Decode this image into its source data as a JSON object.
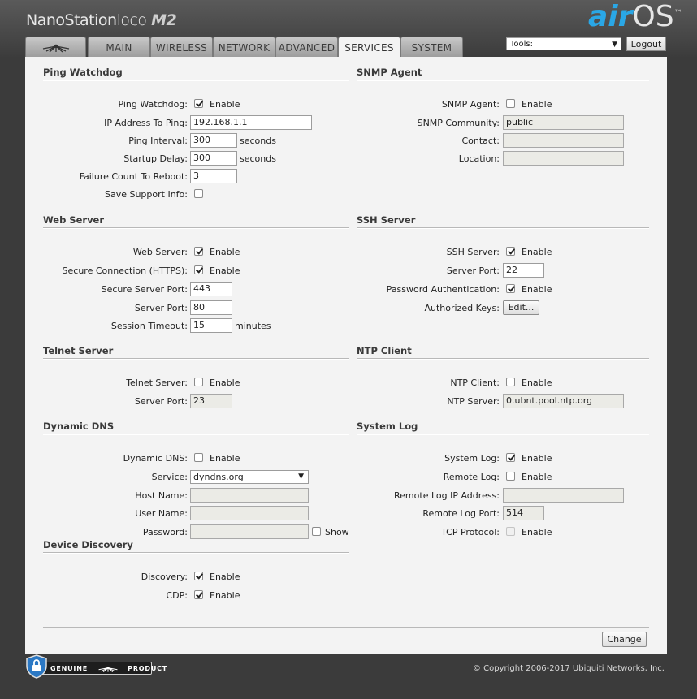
{
  "header": {
    "model_name": "NanoStation",
    "model_sub": "loco",
    "model_suffix": "M2",
    "os_brand_air": "air",
    "os_brand_os": "OS",
    "os_brand_tm": "™"
  },
  "tabs": [
    {
      "label": "",
      "icon": "ubiquiti-logo-icon"
    },
    {
      "label": "MAIN"
    },
    {
      "label": "WIRELESS"
    },
    {
      "label": "NETWORK"
    },
    {
      "label": "ADVANCED"
    },
    {
      "label": "SERVICES",
      "active": true
    },
    {
      "label": "SYSTEM"
    }
  ],
  "toolbar": {
    "tools_value": "Tools:",
    "logout_label": "Logout"
  },
  "common": {
    "enable": "Enable",
    "seconds": "seconds",
    "minutes": "minutes",
    "show": "Show"
  },
  "ping_watchdog": {
    "title": "Ping Watchdog",
    "ping_watchdog_label": "Ping Watchdog:",
    "ping_watchdog_checked": true,
    "ip_label": "IP Address To Ping:",
    "ip_value": "192.168.1.1",
    "interval_label": "Ping Interval:",
    "interval_value": "300",
    "startup_label": "Startup Delay:",
    "startup_value": "300",
    "failure_label": "Failure Count To Reboot:",
    "failure_value": "3",
    "support_label": "Save Support Info:",
    "support_checked": false
  },
  "snmp": {
    "title": "SNMP Agent",
    "agent_label": "SNMP Agent:",
    "agent_checked": false,
    "community_label": "SNMP Community:",
    "community_value": "public",
    "contact_label": "Contact:",
    "contact_value": "",
    "location_label": "Location:",
    "location_value": ""
  },
  "web_server": {
    "title": "Web Server",
    "web_label": "Web Server:",
    "web_checked": true,
    "https_label": "Secure Connection (HTTPS):",
    "https_checked": true,
    "secure_port_label": "Secure Server Port:",
    "secure_port_value": "443",
    "port_label": "Server Port:",
    "port_value": "80",
    "timeout_label": "Session Timeout:",
    "timeout_value": "15"
  },
  "ssh_server": {
    "title": "SSH Server",
    "ssh_label": "SSH Server:",
    "ssh_checked": true,
    "port_label": "Server Port:",
    "port_value": "22",
    "password_label": "Password Authentication:",
    "password_checked": true,
    "keys_label": "Authorized Keys:",
    "edit_label": "Edit..."
  },
  "telnet_server": {
    "title": "Telnet Server",
    "telnet_label": "Telnet Server:",
    "telnet_checked": false,
    "port_label": "Server Port:",
    "port_value": "23"
  },
  "ntp_client": {
    "title": "NTP Client",
    "ntp_label": "NTP Client:",
    "ntp_checked": false,
    "server_label": "NTP Server:",
    "server_value": "0.ubnt.pool.ntp.org"
  },
  "dynamic_dns": {
    "title": "Dynamic DNS",
    "ddns_label": "Dynamic DNS:",
    "ddns_checked": false,
    "service_label": "Service:",
    "service_value": "dyndns.org",
    "host_label": "Host Name:",
    "host_value": "",
    "user_label": "User Name:",
    "user_value": "",
    "password_label": "Password:",
    "password_value": "",
    "show_checked": false
  },
  "system_log": {
    "title": "System Log",
    "log_label": "System Log:",
    "log_checked": true,
    "remote_label": "Remote Log:",
    "remote_checked": false,
    "remote_ip_label": "Remote Log IP Address:",
    "remote_ip_value": "",
    "remote_port_label": "Remote Log Port:",
    "remote_port_value": "514",
    "tcp_label": "TCP Protocol:",
    "tcp_checked": false
  },
  "device_discovery": {
    "title": "Device Discovery",
    "discovery_label": "Discovery:",
    "discovery_checked": true,
    "cdp_label": "CDP:",
    "cdp_checked": true
  },
  "actions": {
    "change_label": "Change"
  },
  "footer": {
    "genuine_left": "GENUINE",
    "genuine_right": "PRODUCT",
    "copyright": "© Copyright 2006-2017 Ubiquiti Networks, Inc."
  }
}
